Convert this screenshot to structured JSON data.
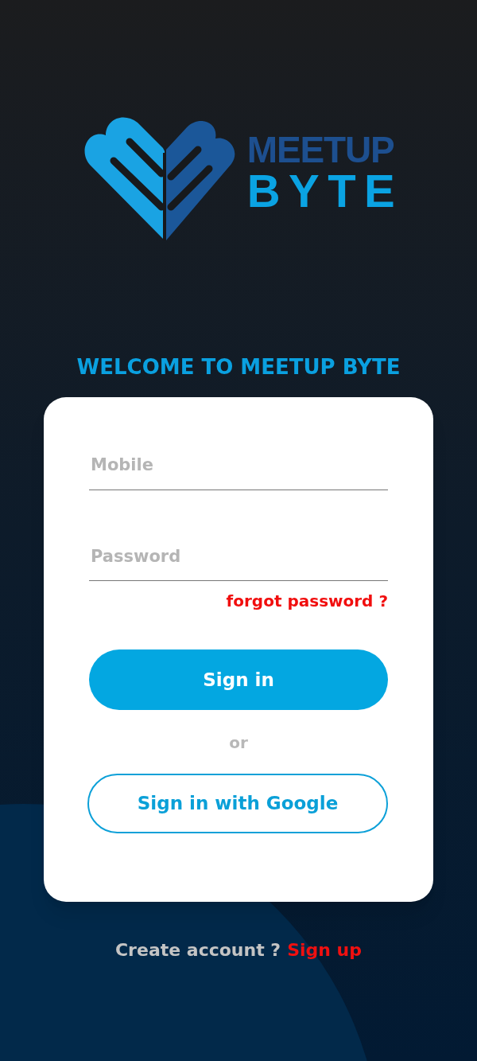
{
  "logo": {
    "line_1": "MEETUP",
    "line_2": "BYTE"
  },
  "welcome_title": "WELCOME TO MEETUP BYTE",
  "form": {
    "fields": [
      {
        "placeholder": "Mobile"
      },
      {
        "placeholder": "Password"
      }
    ],
    "forgot_link": "forgot password ?",
    "sign_in_button": "Sign in",
    "separator": "or",
    "google_button": "Sign in with Google"
  },
  "footer": {
    "prompt": "Create account ?",
    "link": "Sign up"
  }
}
